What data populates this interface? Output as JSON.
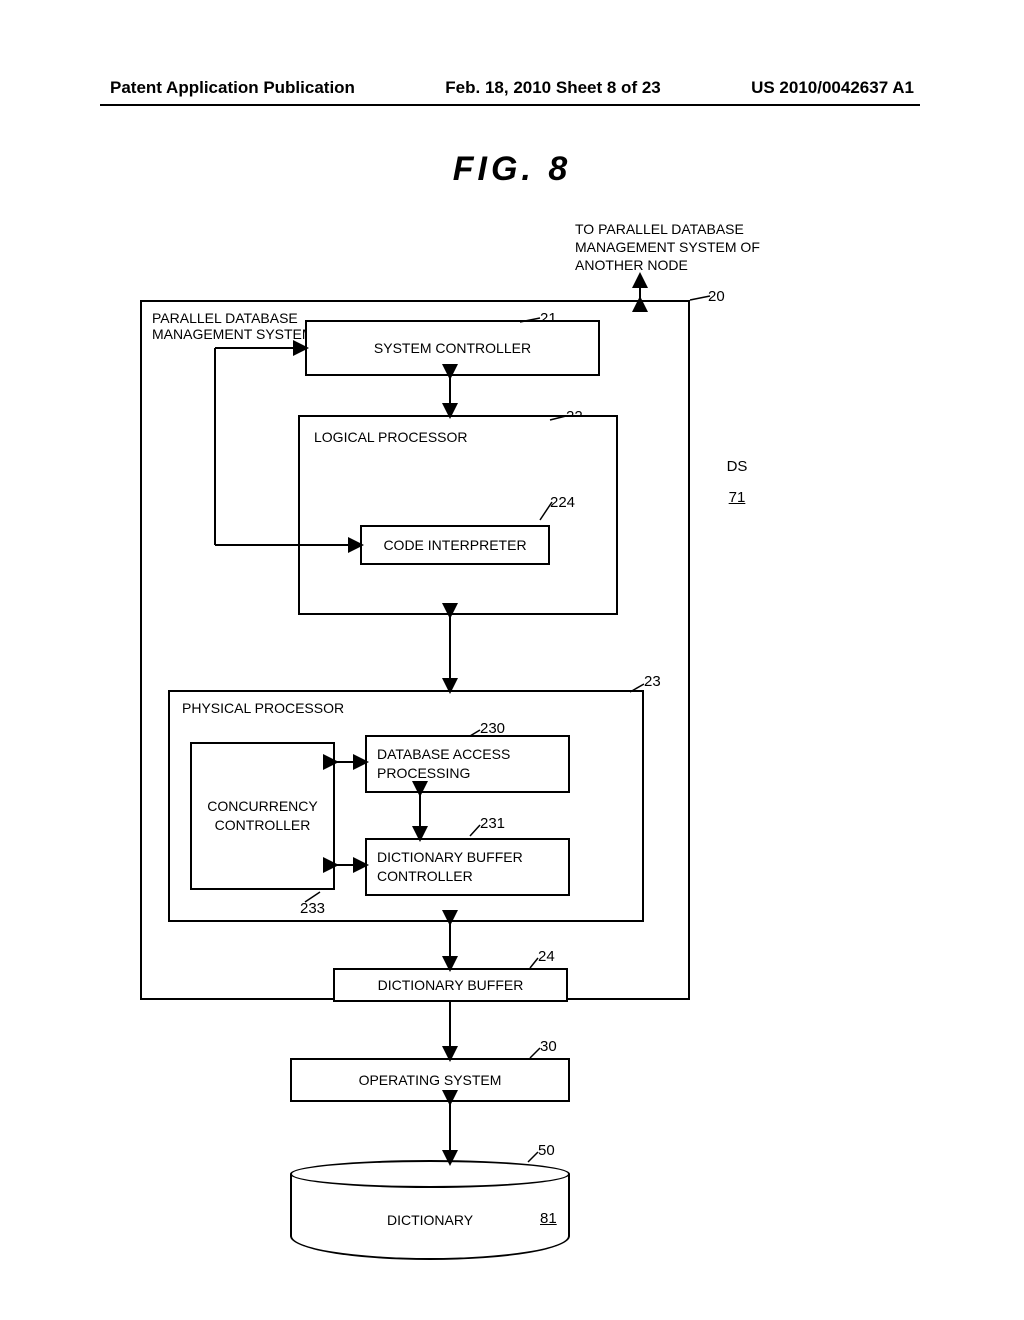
{
  "header": {
    "left": "Patent Application Publication",
    "center": "Feb. 18, 2010  Sheet 8 of 23",
    "right": "US 2010/0042637 A1"
  },
  "figure_title": "FIG.  8",
  "note_top": "TO PARALLEL DATABASE MANAGEMENT SYSTEM OF ANOTHER NODE",
  "blocks": {
    "pdbms": {
      "title": "PARALLEL DATABASE MANAGEMENT SYSTEM"
    },
    "syscontroller": {
      "label": "SYSTEM CONTROLLER"
    },
    "logical": {
      "title": "LOGICAL PROCESSOR"
    },
    "codeint": {
      "label": "CODE INTERPRETER"
    },
    "physical": {
      "title": "PHYSICAL PROCESSOR"
    },
    "concurrency": {
      "label": "CONCURRENCY CONTROLLER"
    },
    "dbaccess": {
      "label": "DATABASE ACCESS PROCESSING"
    },
    "dictbufctrl": {
      "label": "DICTIONARY BUFFER CONTROLLER"
    },
    "dictbuf": {
      "label": "DICTIONARY BUFFER"
    },
    "os": {
      "label": "OPERATING SYSTEM"
    },
    "dictionary": {
      "label": "DICTIONARY"
    }
  },
  "refs": {
    "pdbms": "20",
    "syscontroller": "21",
    "logical": "22",
    "codeint": "224",
    "physical": "23",
    "dbaccess": "230",
    "dictbufctrl": "231",
    "concurrency": "233",
    "dictbuf": "24",
    "os": "30",
    "cylinder": "50",
    "dictionary": "81",
    "ds": "DS",
    "ds_num": "71"
  }
}
